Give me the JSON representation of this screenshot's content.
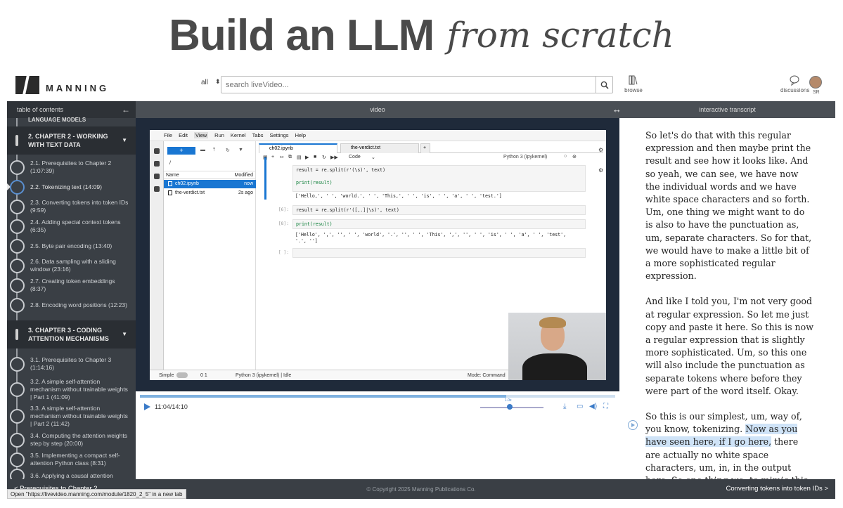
{
  "banner": {
    "main": "Build an LLM",
    "script": "from scratch"
  },
  "header": {
    "brand": "MANNING",
    "scope": "all",
    "search_placeholder": "search liveVideo...",
    "browse_label": "browse",
    "discussions_label": "discussions",
    "user_initials": "SR"
  },
  "sidebar": {
    "title": "table of contents",
    "cutoff_text": "LANGUAGE MODELS",
    "chapters": [
      {
        "label": "2. CHAPTER 2 - WORKING WITH TEXT DATA"
      },
      {
        "label": "3. CHAPTER 3 - CODING ATTENTION MECHANISMS"
      }
    ],
    "ch2_sections": [
      "2.1. Prerequisites to Chapter 2 (1:07:39)",
      "2.2. Tokenizing text (14:09)",
      "2.3. Converting tokens into token IDs (9:59)",
      "2.4. Adding special context tokens (6:35)",
      "2.5. Byte pair encoding (13:40)",
      "2.6. Data sampling with a sliding window (23:16)",
      "2.7. Creating token embeddings (8:37)",
      "2.8. Encoding word positions (12:23)"
    ],
    "ch3_sections": [
      "3.1. Prerequisites to Chapter 3 (1:14:16)",
      "3.2. A simple self-attention mechanism without trainable weights | Part 1 (41:09)",
      "3.3. A simple self-attention mechanism without trainable weights | Part 2 (11:42)",
      "3.4. Computing the attention weights step by step (20:00)",
      "3.5. Implementing a compact self-attention Python class (8:31)",
      "3.6. Applying a causal attention"
    ]
  },
  "video": {
    "header": "video",
    "time": "11:04/14:10",
    "progress": 0.77,
    "speed_label": "1.0x"
  },
  "jupyter": {
    "menu": [
      "File",
      "Edit",
      "View",
      "Run",
      "Kernel",
      "Tabs",
      "Settings",
      "Help"
    ],
    "path": "/",
    "col_name": "Name",
    "col_modified": "Modified",
    "files": [
      {
        "name": "ch02.ipynb",
        "modified": "now"
      },
      {
        "name": "the-verdict.txt",
        "modified": "2s ago"
      }
    ],
    "tabs": [
      "ch02.ipynb",
      "the-verdict.txt"
    ],
    "cell_type": "Code",
    "kernel": "Python 3 (ipykernel)",
    "code1a": "result = re.split(r'(\\s)', text)",
    "code1b": "print(result)",
    "out1": "['Hello,', ' ', 'world.', ' ', 'This,', ' ', 'is', ' ', 'a', ' ', 'test.']",
    "prompt6": "[6]:",
    "code2": "result = re.split(r'([,.]|\\s)', text)",
    "prompt8": "[8]:",
    "code3": "print(result)",
    "out3a": "['Hello', ',', '', ' ', 'world', '.', '', ' ', 'This', ',', '', ' ', 'is', ' ', 'a', ' ', 'test',",
    "out3b": "'.', '']",
    "prompt_empty": "[ ]:",
    "status_left": "Simple",
    "status_counts": "0   1",
    "status_kernel": "Python 3 (ipykernel) | Idle",
    "status_mode": "Mode: Command"
  },
  "transcript": {
    "header": "interactive transcript",
    "p1": "So let's do that with this regular expression and then maybe print the result and see how it looks like. And so yeah, we can see, we have now the individual words and we have white space characters and so forth. Um, one thing we might want to do is also to have the punctuation as, um, separate characters. So for that, we would have to make a little bit of a more sophisticated regular expression.",
    "p2": "And like I told you, I'm not very good at regular expression. So let me just copy and paste it here. So this is now a regular expression that is slightly more sophisticated. Um, so this one will also include the punctuation as separate tokens where before they were part of the word itself. Okay.",
    "p3_pre": "So this is our simplest, um, way of, you know, tokenizing. ",
    "p3_hl": "Now as you have seen here, if I go here,",
    "p3_post": " there are actually no white space characters, um, in, in the output here. So one thing we, to mimic this could be, for example, that we are"
  },
  "footer": {
    "prev": "< Prerequisites to Chapter 2",
    "copyright": "© Copyright 2025 Manning Publications Co.",
    "next": "Converting tokens into token IDs >",
    "status_url": "Open \"https://livevideo.manning.com/module/1820_2_5\" in a new tab"
  },
  "colors": {
    "accent": "#3b7bc8",
    "sidebar_bg": "#3a3f45",
    "highlight": "#cfe3f7"
  }
}
